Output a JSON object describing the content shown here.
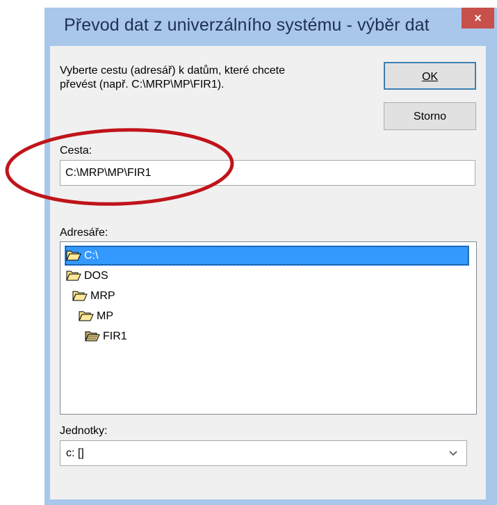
{
  "window": {
    "title": "Převod dat z univerzálního systému - výběr dat",
    "close_glyph": "×"
  },
  "description": {
    "line1": "Vyberte cestu (adresář) k datům, které chcete",
    "line2": "převést (např. C:\\MRP\\MP\\FIR1)."
  },
  "buttons": {
    "ok_label": "OK",
    "cancel_label": "Storno"
  },
  "path": {
    "label": "Cesta:",
    "value": "C:\\MRP\\MP\\FIR1"
  },
  "directories": {
    "label": "Adresáře:",
    "items": [
      {
        "name": "C:\\",
        "icon": "open-folder-icon",
        "selected": true
      },
      {
        "name": "DOS",
        "icon": "open-folder-icon",
        "selected": false
      },
      {
        "name": "MRP",
        "icon": "open-folder-icon",
        "selected": false
      },
      {
        "name": "MP",
        "icon": "open-folder-icon",
        "selected": false
      },
      {
        "name": "FIR1",
        "icon": "current-folder-icon",
        "selected": false
      }
    ]
  },
  "drives": {
    "label": "Jednotky:",
    "value": "c: []"
  },
  "colors": {
    "frame": "#a8c7eb",
    "close": "#c7504b",
    "selection": "#3399ff",
    "annotation": "#c0141b"
  }
}
